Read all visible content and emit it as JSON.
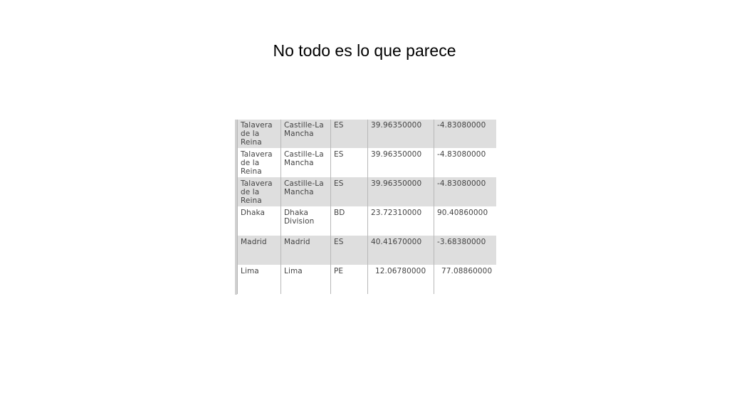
{
  "slide": {
    "title": "No todo es lo que parece"
  },
  "table": {
    "rows": [
      {
        "city": "Talavera de la Reina",
        "region": "Castille-La Mancha",
        "country": "ES",
        "lat": "39.96350000",
        "lon": "-4.83080000",
        "shaded": true
      },
      {
        "city": "Talavera de la Reina",
        "region": "Castille-La Mancha",
        "country": "ES",
        "lat": "39.96350000",
        "lon": "-4.83080000",
        "shaded": false
      },
      {
        "city": "Talavera de la Reina",
        "region": "Castille-La Mancha",
        "country": "ES",
        "lat": "39.96350000",
        "lon": "-4.83080000",
        "shaded": true
      },
      {
        "city": "Dhaka",
        "region": "Dhaka Division",
        "country": "BD",
        "lat": "23.72310000",
        "lon": "90.40860000",
        "shaded": false
      },
      {
        "city": "Madrid",
        "region": "Madrid",
        "country": "ES",
        "lat": "40.41670000",
        "lon": "-3.68380000",
        "shaded": true
      },
      {
        "city": "Lima",
        "region": "Lima",
        "country": "PE",
        "lat": "12.06780000",
        "lon": "77.08860000",
        "shaded": false
      }
    ]
  },
  "colors": {
    "shaded_row": "#dedede",
    "text": "#444444",
    "grid": "#b8b8b8"
  }
}
